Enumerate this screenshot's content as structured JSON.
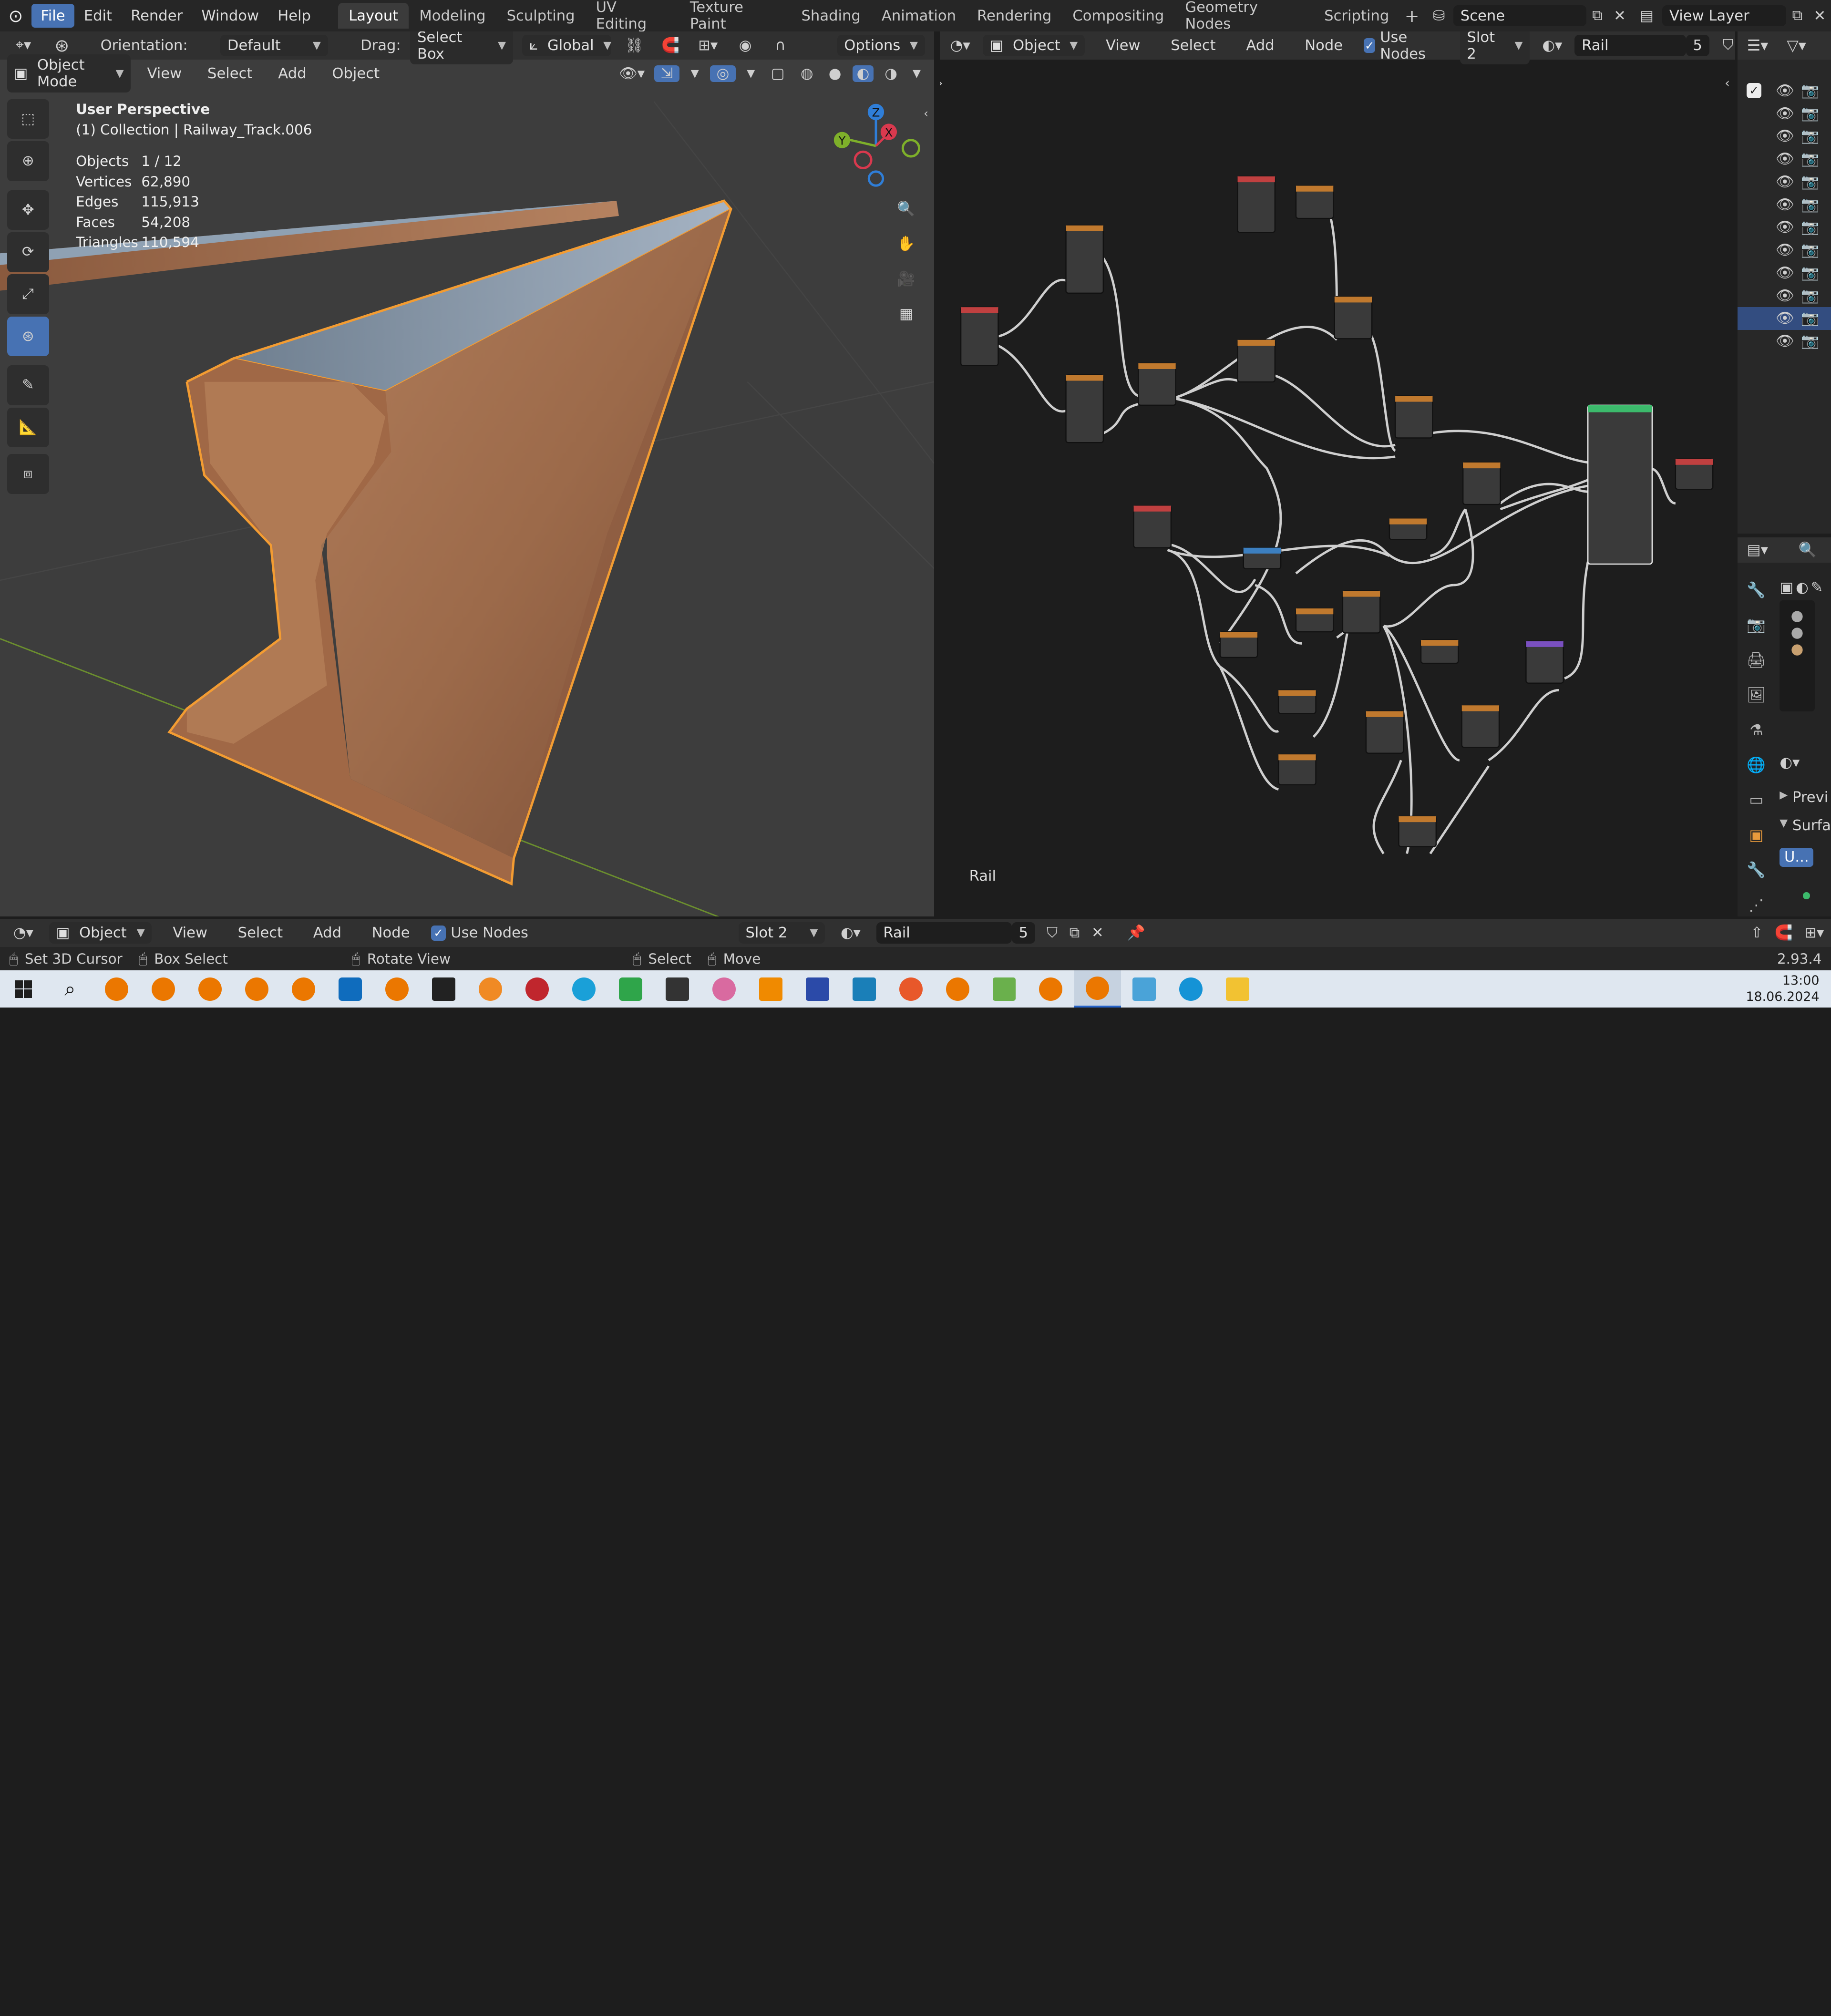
{
  "topbar": {
    "menus": [
      "File",
      "Edit",
      "Render",
      "Window",
      "Help"
    ],
    "workspaces": [
      "Layout",
      "Modeling",
      "Sculpting",
      "UV Editing",
      "Texture Paint",
      "Shading",
      "Animation",
      "Rendering",
      "Compositing",
      "Geometry Nodes",
      "Scripting"
    ],
    "active_workspace": "Layout",
    "scene": "Scene",
    "view_layer": "View Layer"
  },
  "viewport": {
    "header": {
      "orientation_label": "Orientation:",
      "orientation_value": "Default",
      "drag_label": "Drag:",
      "drag_value": "Select Box",
      "transform_value": "Global",
      "options": "Options"
    },
    "header2": {
      "mode": "Object Mode",
      "menus": [
        "View",
        "Select",
        "Add",
        "Object"
      ]
    },
    "overlay": {
      "perspective": "User Perspective",
      "collection": "(1) Collection | Railway_Track.006",
      "stats": [
        {
          "k": "Objects",
          "v": "1 / 12"
        },
        {
          "k": "Vertices",
          "v": "62,890"
        },
        {
          "k": "Edges",
          "v": "115,913"
        },
        {
          "k": "Faces",
          "v": "54,208"
        },
        {
          "k": "Triangles",
          "v": "110,594"
        }
      ]
    },
    "gizmo": {
      "z": "Z",
      "y": "Y",
      "x": "X"
    }
  },
  "node_editor": {
    "header": {
      "type": "Object",
      "menus": [
        "View",
        "Select",
        "Add",
        "Node"
      ],
      "use_nodes": "Use Nodes",
      "slot": "Slot 2",
      "material": "Rail",
      "users": "5"
    },
    "label": "Rail"
  },
  "properties": {
    "panel_previ": "Previ",
    "panel_surfa": "Surfa",
    "surface_value": "U..."
  },
  "bottom_header": {
    "type": "Object",
    "menus": [
      "View",
      "Select",
      "Add",
      "Node"
    ],
    "use_nodes": "Use Nodes",
    "slot": "Slot 2",
    "material": "Rail",
    "users": "5"
  },
  "statusbar": {
    "items": [
      "Set 3D Cursor",
      "Box Select",
      "Rotate View",
      "Select",
      "Move"
    ],
    "version": "2.93.4"
  },
  "taskbar": {
    "time": "13:00",
    "date": "18.06.2024"
  },
  "colors": {
    "accent": "#4772b3",
    "selection_outline": "#f39c32",
    "rail_rust": "#a8714f"
  }
}
